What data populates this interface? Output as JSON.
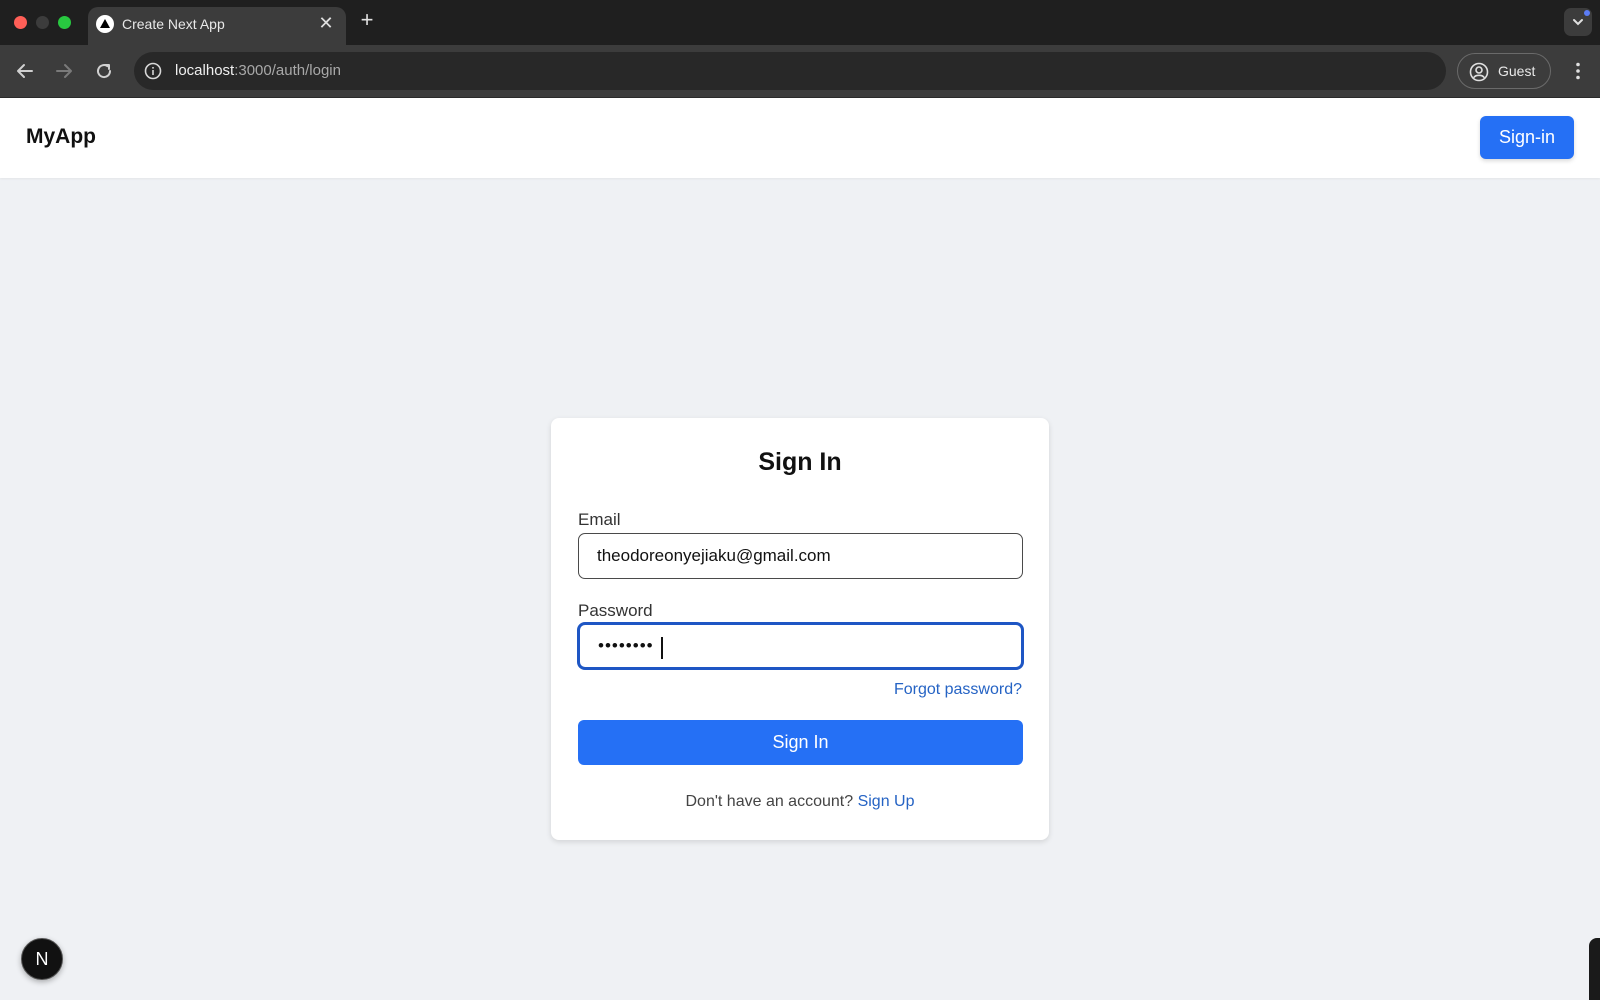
{
  "browser": {
    "tab_title": "Create Next App",
    "tab_close_glyph": "✕",
    "new_tab_glyph": "+",
    "url_host": "localhost",
    "url_path": ":3000/auth/login",
    "profile_label": "Guest"
  },
  "header": {
    "brand": "MyApp",
    "signin_label": "Sign-in"
  },
  "form": {
    "title": "Sign In",
    "email_label": "Email",
    "email_value": "theodoreonyejiaku@gmail.com",
    "password_label": "Password",
    "password_mask": "••••••••",
    "forgot_label": "Forgot password?",
    "submit_label": "Sign In",
    "signup_prompt": "Don't have an account?",
    "signup_link": "Sign Up"
  },
  "dev": {
    "next_badge": "N"
  },
  "colors": {
    "accent": "#2570f5",
    "link": "#2563c4",
    "page_bg": "#eff1f4",
    "focus_ring": "#1e56c4"
  },
  "icons": {
    "back": "arrow-left-icon",
    "forward": "arrow-right-icon",
    "reload": "reload-icon",
    "site_info": "info-icon",
    "profile": "user-circle-icon",
    "menu": "kebab-menu-icon",
    "tab_favicon": "nextjs-triangle-icon"
  }
}
